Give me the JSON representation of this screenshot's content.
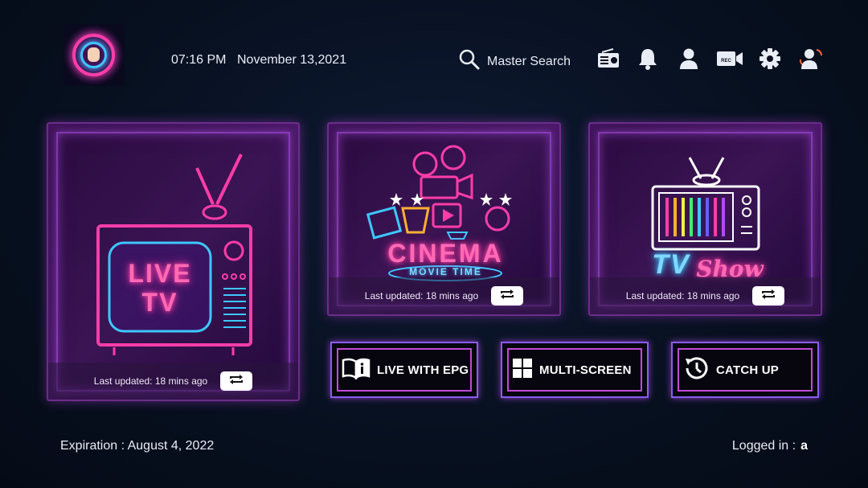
{
  "header": {
    "time": "07:16 PM",
    "date": "November 13,2021",
    "search_label": "Master Search",
    "toolbar_icons": [
      "radio-icon",
      "bell-icon",
      "user-icon",
      "rec-camera-icon",
      "gear-icon",
      "switch-user-icon"
    ],
    "rec_label": "REC"
  },
  "cards": {
    "live": {
      "title_line1": "LIVE",
      "title_line2": "TV",
      "updated": "Last updated: 18 mins ago"
    },
    "cinema": {
      "title": "CINEMA",
      "subtitle": "MOVIE TIME",
      "updated": "Last updated: 18 mins ago"
    },
    "tvshow": {
      "title_tv": "TV",
      "title_show": "Show",
      "updated": "Last updated: 18 mins ago"
    }
  },
  "actions": {
    "epg": "LIVE WITH EPG",
    "multi": "MULTI-SCREEN",
    "catchup": "CATCH UP"
  },
  "footer": {
    "expiration": "Expiration : August 4, 2022",
    "logged_label": "Logged in :",
    "logged_user": "a"
  },
  "colors": {
    "neon_pink": "#ff3da8",
    "neon_purple": "#b04aff",
    "neon_blue": "#3ec7ff",
    "background": "#07101f"
  }
}
